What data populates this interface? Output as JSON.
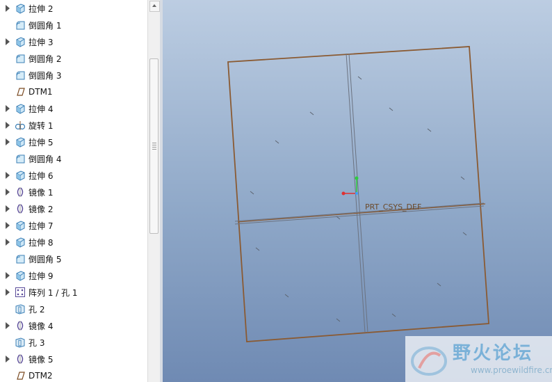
{
  "model_tree": {
    "items": [
      {
        "label": "拉伸 2",
        "icon": "extrude-icon",
        "expandable": true
      },
      {
        "label": "倒圆角 1",
        "icon": "round-icon",
        "expandable": false
      },
      {
        "label": "拉伸 3",
        "icon": "extrude-icon",
        "expandable": true
      },
      {
        "label": "倒圆角 2",
        "icon": "round-icon",
        "expandable": false
      },
      {
        "label": "倒圆角 3",
        "icon": "round-icon",
        "expandable": false
      },
      {
        "label": "DTM1",
        "icon": "datum-plane-icon",
        "expandable": false
      },
      {
        "label": "拉伸 4",
        "icon": "extrude-icon",
        "expandable": true
      },
      {
        "label": "旋转 1",
        "icon": "revolve-icon",
        "expandable": true
      },
      {
        "label": "拉伸 5",
        "icon": "extrude-icon",
        "expandable": true
      },
      {
        "label": "倒圆角 4",
        "icon": "round-icon",
        "expandable": false
      },
      {
        "label": "拉伸 6",
        "icon": "extrude-icon",
        "expandable": true
      },
      {
        "label": "镜像 1",
        "icon": "mirror-icon",
        "expandable": true
      },
      {
        "label": "镜像 2",
        "icon": "mirror-icon",
        "expandable": true
      },
      {
        "label": "拉伸 7",
        "icon": "extrude-icon",
        "expandable": true
      },
      {
        "label": "拉伸 8",
        "icon": "extrude-icon",
        "expandable": true
      },
      {
        "label": "倒圆角 5",
        "icon": "round-icon",
        "expandable": false
      },
      {
        "label": "拉伸 9",
        "icon": "extrude-icon",
        "expandable": true
      },
      {
        "label": "阵列 1 / 孔 1",
        "icon": "pattern-icon",
        "expandable": true
      },
      {
        "label": "孔 2",
        "icon": "hole-icon",
        "expandable": false
      },
      {
        "label": "镜像 4",
        "icon": "mirror-icon",
        "expandable": true
      },
      {
        "label": "孔 3",
        "icon": "hole-icon",
        "expandable": false
      },
      {
        "label": "镜像 5",
        "icon": "mirror-icon",
        "expandable": true
      },
      {
        "label": "DTM2",
        "icon": "datum-plane-icon",
        "expandable": false
      }
    ]
  },
  "viewport": {
    "csys_label": "PRT_CSYS_DEF",
    "edge_color": "#8a5a32",
    "background_top": "#bccde2",
    "background_bottom": "#6f8ab3"
  },
  "watermark": {
    "title": "野火论坛",
    "url": "www.proewildfire.cn"
  }
}
